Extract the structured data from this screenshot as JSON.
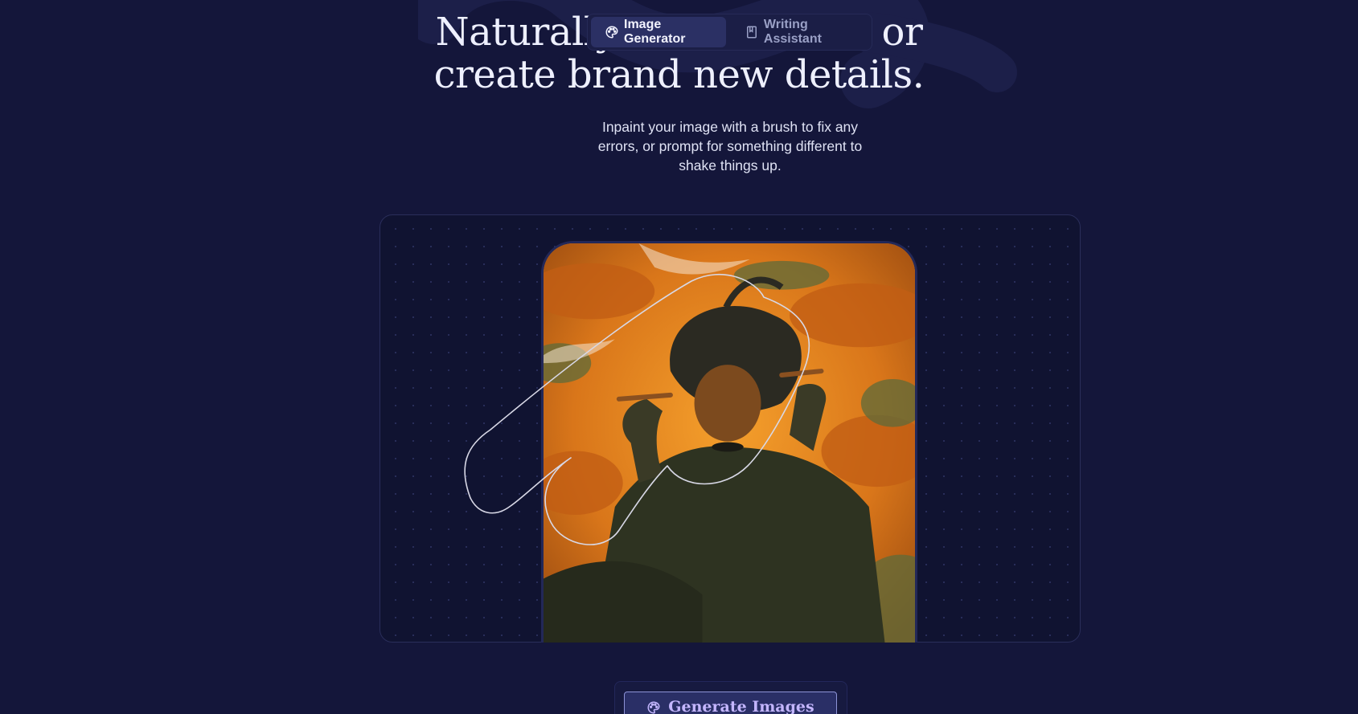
{
  "hero": {
    "headline_line1": "Naturally fix mistakes, or",
    "headline_line2": "create brand new details.",
    "subtitle": "Inpaint your image with a brush to fix any errors, or prompt for something different to shake things up."
  },
  "tabs": [
    {
      "label": "Image Generator",
      "icon": "palette-icon",
      "active": true
    },
    {
      "label": "Writing Assistant",
      "icon": "book-icon",
      "active": false
    }
  ],
  "canvas": {
    "artwork_description_icon": "inpaint-mask-brush-icon"
  },
  "actions": {
    "generate_label": "Generate Images",
    "generate_icon": "palette-icon"
  },
  "colors": {
    "background": "#14163a",
    "accent": "#c4b6ff",
    "artwork_orange": "#d97a18"
  }
}
